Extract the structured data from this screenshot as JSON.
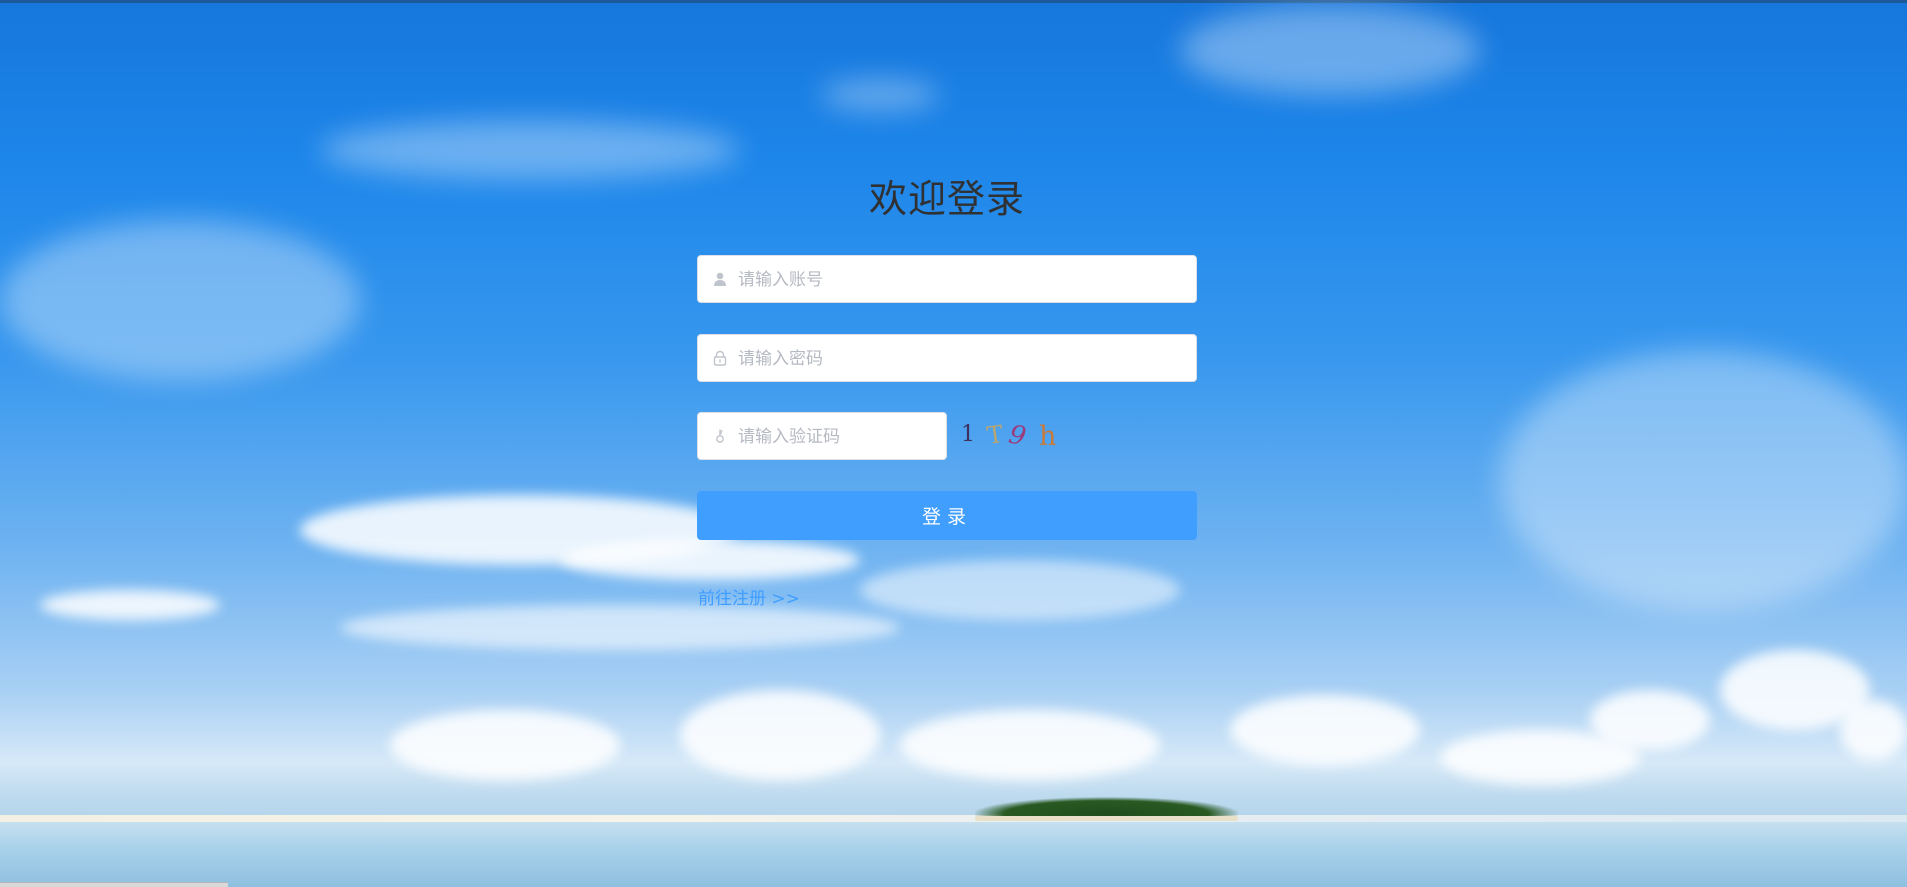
{
  "background": {
    "scene": "sky-sea-island",
    "colors": {
      "sky_top": "#1676dc",
      "sky_mid": "#3797ee",
      "horizon": "#d6e9f8",
      "sea": "#a9d1ea"
    }
  },
  "login": {
    "title": "欢迎登录",
    "username": {
      "placeholder": "请输入账号",
      "value": "",
      "icon": "user-icon"
    },
    "password": {
      "placeholder": "请输入密码",
      "value": "",
      "icon": "lock-icon"
    },
    "captcha_input": {
      "placeholder": "请输入验证码",
      "value": "",
      "icon": "key-icon"
    },
    "captcha_chars": [
      {
        "char": "1",
        "color": "#3f2f5e"
      },
      {
        "char": "T",
        "color": "#b9a56e"
      },
      {
        "char": "9",
        "color": "#9a3c7c"
      },
      {
        "char": "h",
        "color": "#c97a3a"
      }
    ],
    "submit_label": "登录",
    "register_link": "前往注册 >>"
  },
  "theme": {
    "accent": "#409eff",
    "title_color": "#303133"
  }
}
